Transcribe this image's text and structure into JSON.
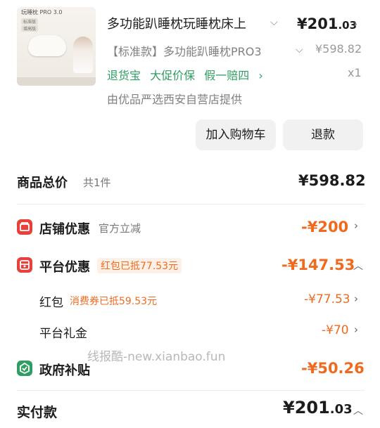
{
  "product": {
    "thumbnail": {
      "title": "玩睡枕 PRO 3.0",
      "tags": [
        "标准版",
        "增高版"
      ]
    },
    "title": "多功能趴睡枕玩睡枕床上",
    "variant": "【标准款】多功能趴睡枕PRO3",
    "price_integer": "¥201",
    "price_decimal": ".03",
    "original_price": "¥598.82",
    "service_tags": [
      "退货宝",
      "大促价保",
      "假一赔四"
    ],
    "quantity": "x1",
    "seller": "由优品严选西安自营店提供"
  },
  "actions": {
    "add_to_cart": "加入购物车",
    "refund": "退款"
  },
  "summary": {
    "total_label": "商品总价",
    "total_count": "共1件",
    "total_amount": "¥598.82"
  },
  "discounts": {
    "store": {
      "label": "店铺优惠",
      "sub": "官方立减",
      "amount": "-¥200"
    },
    "platform": {
      "label": "平台优惠",
      "sub": "红包已抵77.53元",
      "amount": "-¥147.53",
      "items": [
        {
          "label": "红包",
          "sub": "消费券已抵59.53元",
          "amount": "-¥77.53"
        },
        {
          "label": "平台礼金",
          "sub": "",
          "amount": "-¥70"
        }
      ]
    },
    "government": {
      "label": "政府补贴",
      "amount": "-¥50.26"
    }
  },
  "watermark": "线报酷-new.xianbao.fun",
  "payment": {
    "label": "实付款",
    "amount_integer": "¥201",
    "amount_decimal": ".03"
  },
  "colors": {
    "accent_orange": "#ef6a1f",
    "service_green": "#2e9e62",
    "icon_red": "#e8403a"
  }
}
